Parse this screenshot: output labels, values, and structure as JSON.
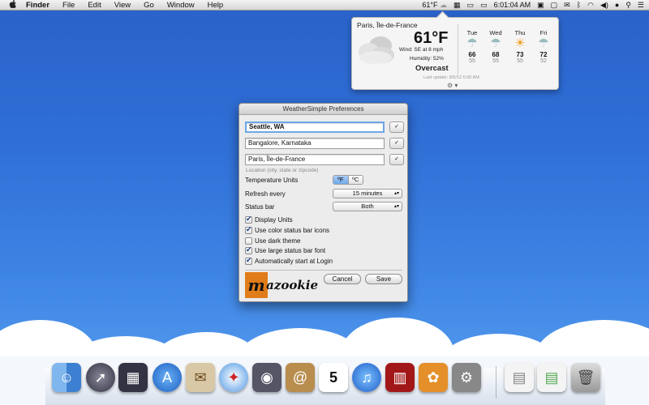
{
  "menubar": {
    "apple": "",
    "app_name": "Finder",
    "menus": [
      "File",
      "Edit",
      "View",
      "Go",
      "Window",
      "Help"
    ],
    "weather_status": "61°F",
    "clock": "6:01:04 AM"
  },
  "weather": {
    "city": "Paris, Île-de-France",
    "temp": "61°F",
    "wind": "Wind: SE at 8 mph",
    "humidity": "Humidity: 52%",
    "condition": "Overcast",
    "last_update": "Last update: 8/5/12 6:00 AM",
    "forecast": [
      {
        "day": "Tue",
        "hi": "66",
        "lo": "55",
        "icon": "rain-cloud-icon"
      },
      {
        "day": "Wed",
        "hi": "68",
        "lo": "55",
        "icon": "rain-cloud-icon"
      },
      {
        "day": "Thu",
        "hi": "73",
        "lo": "55",
        "icon": "sun-cloud-icon"
      },
      {
        "day": "Fri",
        "hi": "72",
        "lo": "52",
        "icon": "rain-cloud-icon"
      }
    ]
  },
  "prefs": {
    "title": "WeatherSimple Preferences",
    "locations": [
      "Seattle, WA",
      "Bangalore, Karnataka",
      "Paris, Île-de-France"
    ],
    "check_label": "✓",
    "location_hint": "Location (city, state or zipcode)",
    "temp_units_label": "Temperature Units",
    "unit_f": "ºF",
    "unit_c": "ºC",
    "refresh_label": "Refresh every",
    "refresh_value": "15 minutes",
    "statusbar_label": "Status bar",
    "statusbar_value": "Both",
    "options": [
      {
        "label": "Display Units",
        "checked": true
      },
      {
        "label": "Use color status bar icons",
        "checked": true
      },
      {
        "label": "Use dark theme",
        "checked": false
      },
      {
        "label": "Use large status bar font",
        "checked": true
      },
      {
        "label": "Automatically start at Login",
        "checked": true
      }
    ],
    "logo_m": "m",
    "logo_text": "azookie",
    "cancel": "Cancel",
    "save": "Save"
  },
  "dock": {
    "calendar_day": "5",
    "items": [
      "finder-icon",
      "launchpad-icon",
      "mission-control-icon",
      "app-store-icon",
      "mail-icon",
      "safari-icon",
      "facetime-icon",
      "address-book-icon",
      "calendar-icon",
      "itunes-icon",
      "photo-booth-icon",
      "iphoto-icon",
      "system-preferences-icon",
      "document-icon",
      "document-icon",
      "trash-icon"
    ]
  }
}
